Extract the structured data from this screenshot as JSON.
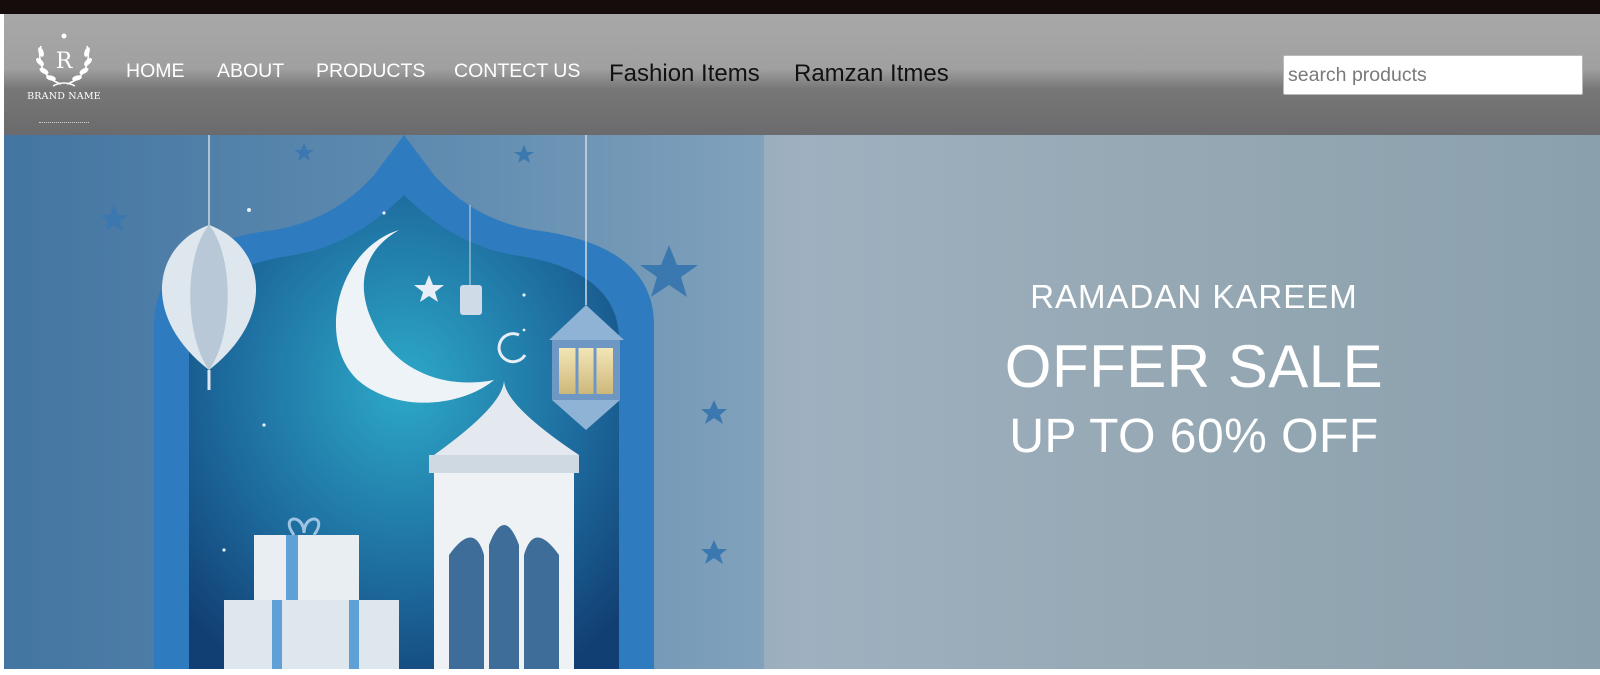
{
  "brand": {
    "name": "BRAND NAME",
    "monogram": "R",
    "icon": "laurel-crest-logo"
  },
  "nav": {
    "items": [
      {
        "label": "HOME"
      },
      {
        "label": "ABOUT"
      },
      {
        "label": "PRODUCTS"
      },
      {
        "label": "CONTECT US"
      }
    ],
    "extra": [
      {
        "label": "Fashion Items"
      },
      {
        "label": "Ramzan Itmes"
      }
    ]
  },
  "search": {
    "placeholder": "search products",
    "value": ""
  },
  "hero": {
    "subtitle": "RAMADAN KAREEM",
    "title": "OFFER SALE",
    "discount": "UP TO 60% OFF",
    "image": "ramadan-lantern-crescent-illustration"
  },
  "colors": {
    "topbar": "#150c0c",
    "header": "#a0a0a0",
    "hero_text": "#ffffff",
    "hero_background": "#8fa7b8"
  }
}
